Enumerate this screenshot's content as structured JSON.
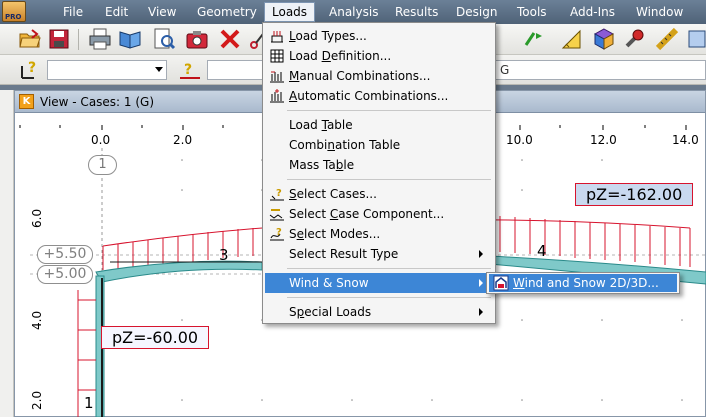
{
  "app": {
    "logo_text": "PRO"
  },
  "menubar": {
    "items": [
      "File",
      "Edit",
      "View",
      "Geometry",
      "Loads",
      "Analysis",
      "Results",
      "Design",
      "Tools",
      "Add-Ins",
      "Window"
    ],
    "active": "Loads"
  },
  "toolbar": {
    "combo1_value": "",
    "combo2_value": "",
    "combo3_value": "G"
  },
  "view": {
    "title": "View - Cases: 1 (G)",
    "icon_letter": "K"
  },
  "canvas": {
    "x_ticks": [
      "0.0",
      "2.0",
      "10.0",
      "12.0",
      "14.0"
    ],
    "y_ticks": [
      "6.0",
      "4.0",
      "2.0"
    ],
    "level_labels": [
      "+5.50",
      "+5.00"
    ],
    "node_label": "1",
    "member_labels": [
      "3",
      "4",
      "1"
    ],
    "load_top": "pZ=-162.00",
    "load_side": "pZ=-60.00"
  },
  "loads_menu": {
    "items": [
      {
        "pre": "",
        "ul": "L",
        "post": "oad Types...",
        "icon": "load-types-icon"
      },
      {
        "pre": "Load ",
        "ul": "D",
        "post": "efinition...",
        "icon": "load-definition-icon"
      },
      {
        "pre": "",
        "ul": "M",
        "post": "anual Combinations...",
        "icon": "manual-combinations-icon"
      },
      {
        "pre": "",
        "ul": "A",
        "post": "utomatic Combinations...",
        "icon": "automatic-combinations-icon"
      },
      {
        "pre": "Load ",
        "ul": "T",
        "post": "able",
        "icon": ""
      },
      {
        "pre": "Combi",
        "ul": "n",
        "post": "ation Table",
        "icon": ""
      },
      {
        "pre": "Mass Ta",
        "ul": "b",
        "post": "le",
        "icon": ""
      },
      {
        "pre": "",
        "ul": "S",
        "post": "elect Cases...",
        "icon": "select-cases-icon"
      },
      {
        "pre": "Select ",
        "ul": "C",
        "post": "ase Component...",
        "icon": "select-case-component-icon"
      },
      {
        "pre": "S",
        "ul": "e",
        "post": "lect Modes...",
        "icon": "select-modes-icon"
      },
      {
        "pre": "Select Result Type",
        "ul": "",
        "post": "",
        "icon": ""
      },
      {
        "pre": "Wind & Snow",
        "ul": "",
        "post": "",
        "icon": ""
      },
      {
        "pre": "S",
        "ul": "p",
        "post": "ecial Loads",
        "icon": ""
      }
    ],
    "submenu": {
      "pre": "",
      "ul": "W",
      "post": "ind and Snow 2D/3D..."
    }
  },
  "colors": {
    "menubar": "#5b6f86",
    "highlight": "#3d86d6",
    "load_red": "#d7142e",
    "member_teal": "#7fc9c9"
  }
}
